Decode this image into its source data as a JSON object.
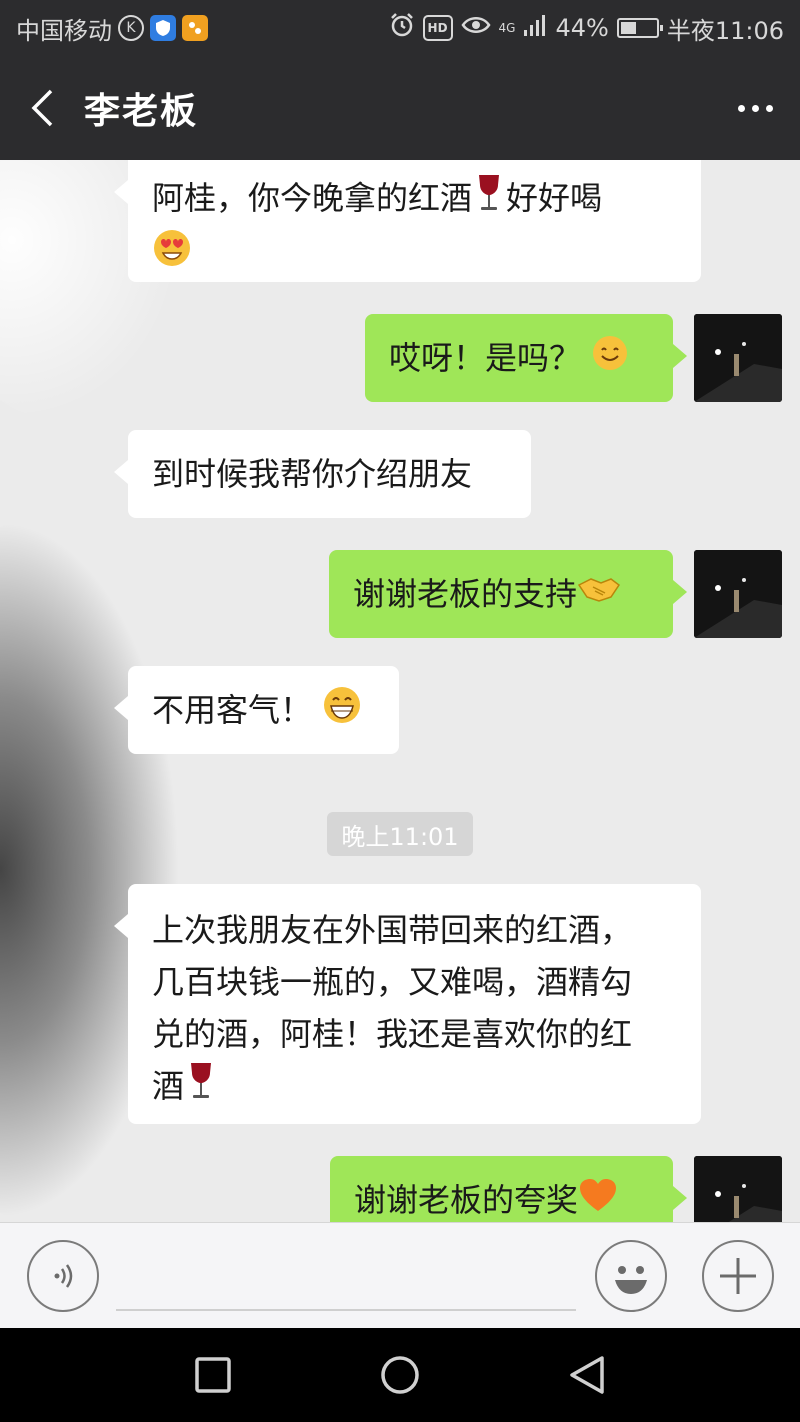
{
  "status_bar": {
    "carrier": "中国移动",
    "k_badge": "K",
    "hd_badge": "HD",
    "network": "4G",
    "battery": "44%",
    "battery_level": 0.44,
    "time": "半夜11:06"
  },
  "header": {
    "title": "李老板",
    "back_icon": "chevron-left-icon",
    "more_icon": "more-dots-icon"
  },
  "messages": [
    {
      "side": "in",
      "text": "阿桂，你今晚拿的红酒",
      "emoji_mid": "wine-glass-icon",
      "text_after": "好好喝",
      "emoji_end": "heart-eyes-emoji"
    },
    {
      "side": "out",
      "text": "哎呀！是吗？",
      "emoji_end": "smile-emoji"
    },
    {
      "side": "in",
      "text": "到时候我帮你介绍朋友"
    },
    {
      "side": "out",
      "text": "谢谢老板的支持",
      "emoji_end": "handshake-emoji"
    },
    {
      "side": "in",
      "text": "不用客气！",
      "emoji_end": "grin-emoji"
    },
    {
      "side": "in",
      "lines": [
        "上次我朋友在外国带回来的红酒，",
        "几百块钱一瓶的，又难喝，酒精勾",
        "兑的酒，阿桂！我还是喜欢你的红",
        "酒"
      ],
      "emoji_end": "wine-glass-icon"
    },
    {
      "side": "out",
      "text": "谢谢老板的夸奖",
      "emoji_end": "orange-heart-emoji"
    }
  ],
  "timestamp": "晚上11:01",
  "input_bar": {
    "voice_icon": "voice-icon",
    "emoji_icon": "emoji-face-icon",
    "add_icon": "plus-icon"
  },
  "nav_bar": {
    "recent_icon": "square-icon",
    "home_icon": "circle-icon",
    "back_icon": "triangle-back-icon"
  },
  "colors": {
    "header_bg": "#2c2c2e",
    "chat_bg": "#ebebeb",
    "out_bubble": "#9fe658",
    "in_bubble": "#ffffff"
  }
}
